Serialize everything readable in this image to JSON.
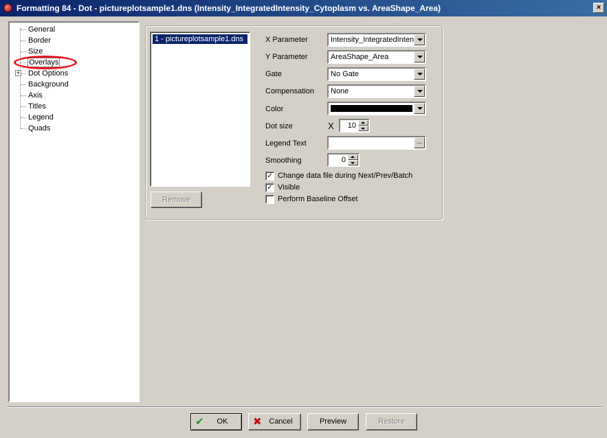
{
  "window": {
    "title": "Formatting 84 - Dot - pictureplotsample1.dns (Intensity_IntegratedIntensity_Cytoplasm vs. AreaShape_Area)",
    "close_label": "×"
  },
  "tree": {
    "items": [
      {
        "label": "General"
      },
      {
        "label": "Border"
      },
      {
        "label": "Size"
      },
      {
        "label": "Overlays"
      },
      {
        "label": "Dot Options"
      },
      {
        "label": "Background"
      },
      {
        "label": "Axis"
      },
      {
        "label": "Titles"
      },
      {
        "label": "Legend"
      },
      {
        "label": "Quads"
      }
    ],
    "expander_label": "+"
  },
  "overlays": {
    "files": [
      {
        "label": "1 - pictureplotsample1.dns"
      }
    ],
    "remove_label": "Remove",
    "x_parameter": {
      "label": "X Parameter",
      "value": "Intensity_IntegratedIntensity_Cytoplasm"
    },
    "y_parameter": {
      "label": "Y Parameter",
      "value": "AreaShape_Area"
    },
    "gate": {
      "label": "Gate",
      "value": "No Gate"
    },
    "compensation": {
      "label": "Compensation",
      "value": "None"
    },
    "color": {
      "label": "Color",
      "value": "#000000"
    },
    "dot_size": {
      "label": "Dot size",
      "symbol": "X",
      "value": "10"
    },
    "legend_text": {
      "label": "Legend Text",
      "value": "",
      "browse_label": "..."
    },
    "smoothing": {
      "label": "Smoothing",
      "value": "0"
    },
    "checkboxes": [
      {
        "label": "Change data file during Next/Prev/Batch",
        "checked": true,
        "mark": "✓"
      },
      {
        "label": "Visible",
        "checked": true,
        "mark": "✓"
      },
      {
        "label": "Perform Baseline Offset",
        "checked": false,
        "mark": ""
      }
    ]
  },
  "footer": {
    "ok_label": "OK",
    "cancel_label": "Cancel",
    "preview_label": "Preview",
    "restore_label": "Restore"
  },
  "colors": {
    "highlight_ring": "#e8141c",
    "selection": "#0a246a"
  }
}
